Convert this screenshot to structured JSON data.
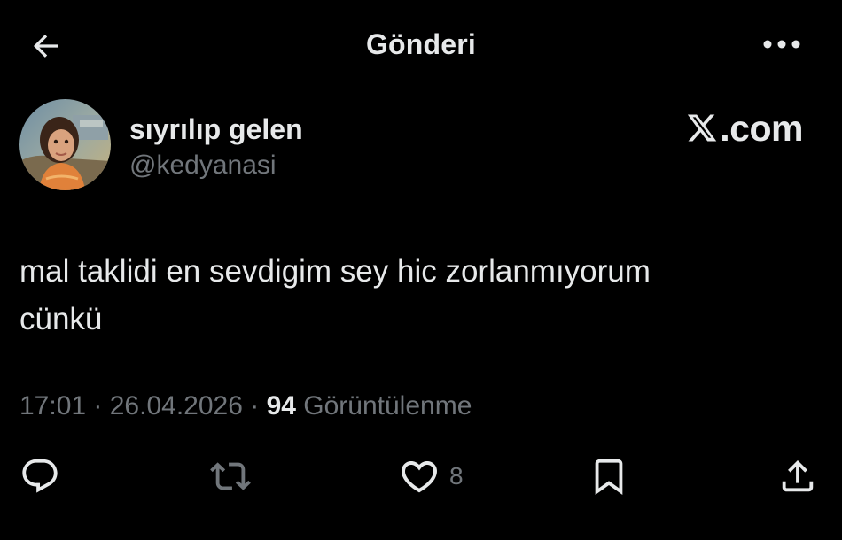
{
  "header": {
    "title": "Gönderi",
    "back_icon": "arrow-left-icon",
    "more_icon": "more-horizontal-icon"
  },
  "author": {
    "display_name": "sıyrılıp gelen",
    "handle": "@kedyanasi"
  },
  "brand": {
    "label": ".com",
    "icon": "x-logo-icon"
  },
  "tweet": {
    "text": "mal taklidi en sevdigim sey hic zorlanmıyorum\ncünkü"
  },
  "meta": {
    "time": "17:01",
    "separator": " · ",
    "date": "26.04.2026",
    "views_count": "94",
    "views_label": " Görüntülenme"
  },
  "actions": {
    "reply_icon": "reply-icon",
    "retweet_icon": "retweet-icon",
    "like_icon": "heart-icon",
    "like_count": "8",
    "bookmark_icon": "bookmark-icon",
    "share_icon": "share-icon"
  },
  "colors": {
    "background": "#000000",
    "primary_text": "#e7e9ea",
    "secondary_text": "#71767b"
  }
}
